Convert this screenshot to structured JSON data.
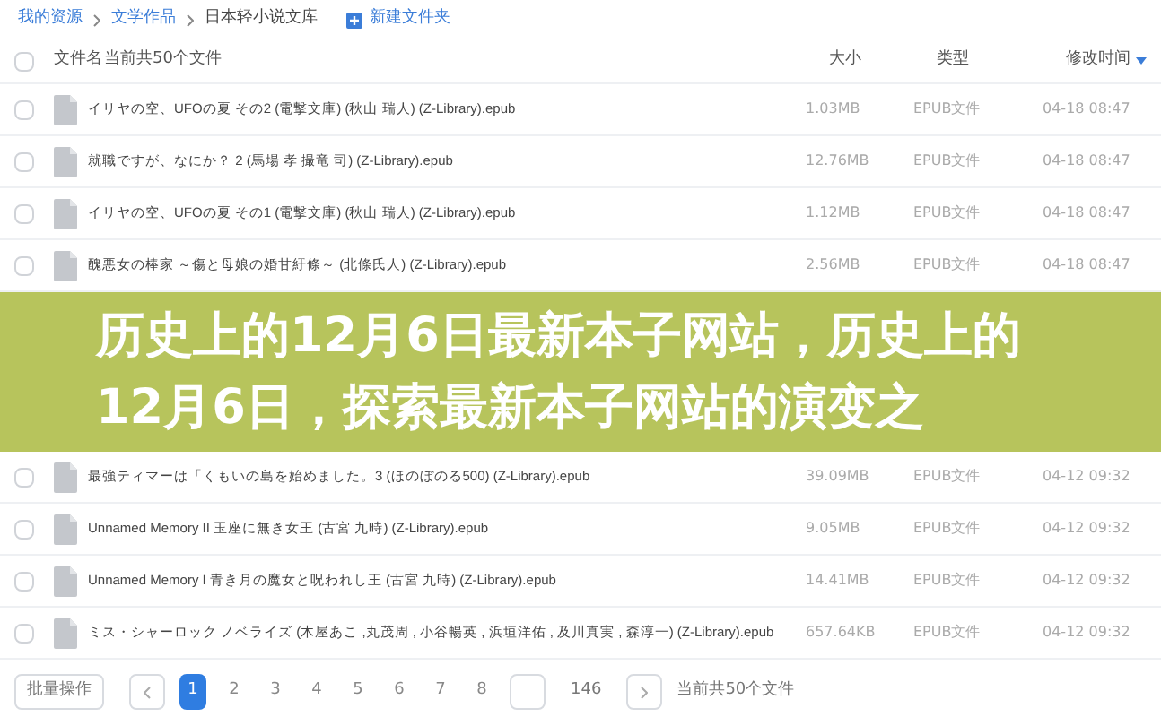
{
  "breadcrumb": [
    {
      "label": "我的资源"
    },
    {
      "label": "文学作品"
    },
    {
      "label": "日本轻小说文库"
    }
  ],
  "new_folder_button": "新建文件夹",
  "table": {
    "all_checked": false,
    "columns": [
      "文件名",
      "当前共50个文件",
      "大小",
      "类型",
      "修改时间"
    ],
    "rows_above": [
      {
        "name": "イリヤの空、UFOの夏 その2 (電撃文庫) (秋山 瑞人) (Z-Library).epub",
        "size": "1.03MB",
        "type": "EPUB文件",
        "time": "04-18 08:47",
        "checked": false
      },
      {
        "name": "就職ですが、なにか？ 2 (馬場 孝 撮竜 司) (Z-Library).epub",
        "size": "12.76MB",
        "type": "EPUB文件",
        "time": "04-18 08:47",
        "checked": false
      },
      {
        "name": "イリヤの空、UFOの夏 その1 (電撃文庫) (秋山 瑞人) (Z-Library).epub",
        "size": "1.12MB",
        "type": "EPUB文件",
        "time": "04-18 08:47",
        "checked": false
      },
      {
        "name": "醜悪女の棒家 ～傷と母娘の婚甘紆條～ (北條氏人) (Z-Library).epub",
        "size": "2.56MB",
        "type": "EPUB文件",
        "time": "04-18 08:47",
        "checked": false
      }
    ],
    "rows_below": [
      {
        "name": "最強ティマーは「くもいの島を始めました。3 (ほのぼのる500) (Z-Library).epub",
        "size": "39.09MB",
        "type": "EPUB文件",
        "time": "04-12 09:32",
        "checked": false
      },
      {
        "name": "Unnamed Memory II 玉座に無き女王 (古宮 九時) (Z-Library).epub",
        "size": "9.05MB",
        "type": "EPUB文件",
        "time": "04-12 09:32",
        "checked": false
      },
      {
        "name": "Unnamed Memory I 青き月の魔女と呪われし王 (古宮 九時) (Z-Library).epub",
        "size": "14.41MB",
        "type": "EPUB文件",
        "time": "04-12 09:32",
        "checked": false
      },
      {
        "name": "ミス・シャーロック ノベライズ (木屋あこ ,丸茂周 , 小谷暢英 , 浜垣洋佑 , 及川真実 , 森淳一) (Z-Library).epub",
        "size": "657.64KB",
        "type": "EPUB文件",
        "time": "04-12 09:32",
        "checked": false
      }
    ]
  },
  "banner": {
    "title": "历史上的12月6日最新本子网站，历史上的12月6日，探索最新本子网站的演变之"
  },
  "pagination": {
    "bulk_button": "批量操作",
    "pages": [
      {
        "label": "1",
        "selected": true
      },
      {
        "label": "2",
        "selected": false
      },
      {
        "label": "3",
        "selected": false
      },
      {
        "label": "4",
        "selected": false
      },
      {
        "label": "5",
        "selected": false
      },
      {
        "label": "6",
        "selected": false
      },
      {
        "label": "7",
        "selected": false
      },
      {
        "label": "8",
        "selected": false
      }
    ],
    "last_page": "146",
    "summary": "当前共50个文件"
  }
}
